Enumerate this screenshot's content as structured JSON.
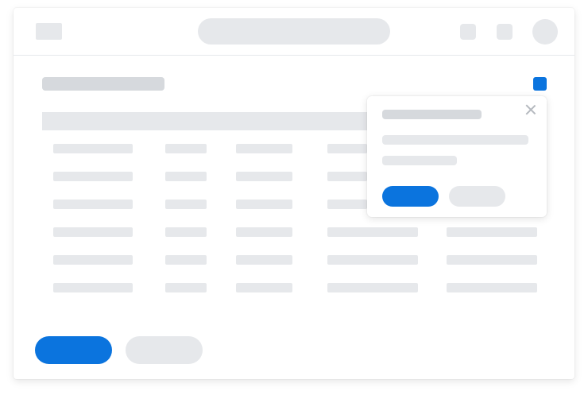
{
  "app": {
    "topbar": {
      "icons": [
        "logo-placeholder",
        "notification-icon",
        "settings-icon",
        "user-avatar"
      ],
      "search": {
        "placeholder": ""
      }
    },
    "header": {
      "title": "",
      "action_icon": "blue-square-icon"
    },
    "table": {
      "columns": [
        "",
        "",
        "",
        "",
        ""
      ],
      "rows": [
        [
          "",
          "",
          "",
          "",
          ""
        ],
        [
          "",
          "",
          "",
          "",
          ""
        ],
        [
          "",
          "",
          "",
          "",
          ""
        ],
        [
          "",
          "",
          "",
          "",
          ""
        ],
        [
          "",
          "",
          "",
          "",
          ""
        ],
        [
          "",
          "",
          "",
          "",
          ""
        ]
      ]
    },
    "footer": {
      "primary_label": "",
      "secondary_label": ""
    },
    "popover": {
      "title": "",
      "body_lines": [
        "",
        ""
      ],
      "primary_label": "",
      "secondary_label": "",
      "close_icon": "close-icon"
    }
  },
  "colors": {
    "primary": "#0b74de",
    "placeholder": "#e6e8eb",
    "placeholder_dark": "#d6d9dd",
    "divider": "#e6e8eb"
  }
}
